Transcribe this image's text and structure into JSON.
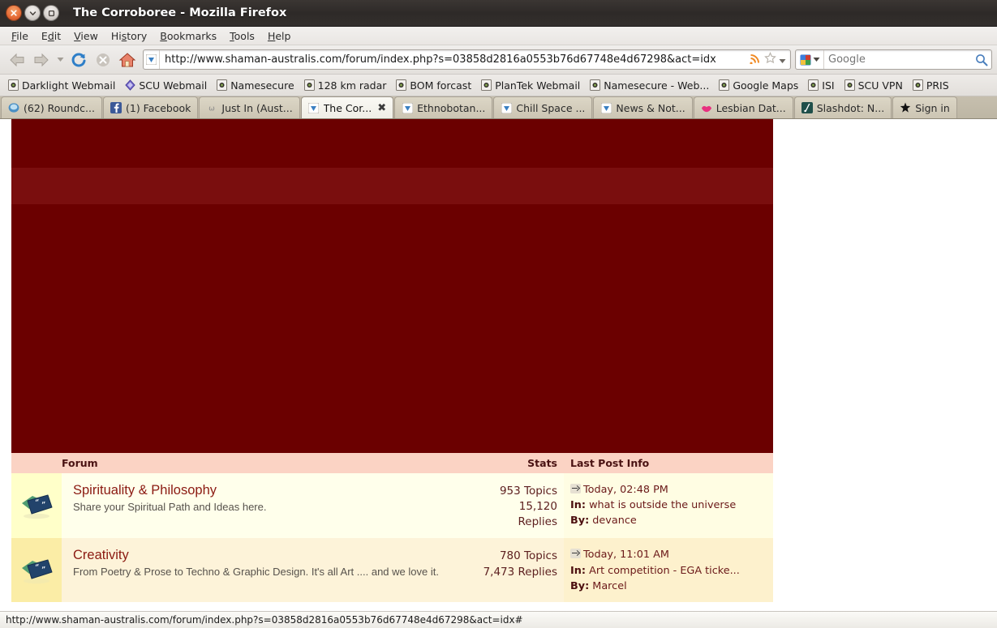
{
  "window": {
    "title": "The Corroboree - Mozilla Firefox",
    "buttons": {
      "close": "close-button",
      "minimize": "minimize-button",
      "maximize": "maximize-button"
    }
  },
  "menubar": {
    "items": [
      {
        "label": "File",
        "accel": "F"
      },
      {
        "label": "Edit",
        "accel": "E"
      },
      {
        "label": "View",
        "accel": "V"
      },
      {
        "label": "History",
        "accel": "s"
      },
      {
        "label": "Bookmarks",
        "accel": "B"
      },
      {
        "label": "Tools",
        "accel": "T"
      },
      {
        "label": "Help",
        "accel": "H"
      }
    ]
  },
  "toolbar": {
    "back_icon": "back-arrow-icon",
    "forward_icon": "forward-arrow-icon",
    "dropdown_icon": "history-dropdown-icon",
    "reload_icon": "reload-icon",
    "stop_icon": "stop-icon",
    "home_icon": "home-icon",
    "url": "http://www.shaman-australis.com/forum/index.php?s=03858d2816a0553b76d67748e4d67298&act=idx",
    "site_identity_icon": "site-favicon",
    "feed_icon": "rss-feed-icon",
    "bookmark_star_icon": "bookmark-star-icon",
    "url_dropdown_icon": "url-dropdown-icon",
    "search_engine": "Google",
    "search_placeholder": "Google",
    "search_value": "",
    "search_go_icon": "search-magnifier-icon"
  },
  "bookmarks": {
    "items": [
      {
        "label": "Darklight Webmail",
        "icon": "generic-page-icon"
      },
      {
        "label": "SCU Webmail",
        "icon": "diamond-icon"
      },
      {
        "label": "Namesecure",
        "icon": "generic-page-icon"
      },
      {
        "label": "128 km radar",
        "icon": "generic-page-icon"
      },
      {
        "label": "BOM forcast",
        "icon": "generic-page-icon"
      },
      {
        "label": "PlanTek Webmail",
        "icon": "generic-page-icon"
      },
      {
        "label": "Namesecure - Web...",
        "icon": "generic-page-icon"
      },
      {
        "label": "Google Maps",
        "icon": "generic-page-icon"
      },
      {
        "label": "ISI",
        "icon": "generic-page-icon"
      },
      {
        "label": "SCU VPN",
        "icon": "generic-page-icon"
      },
      {
        "label": "PRIS",
        "icon": "generic-page-icon"
      }
    ]
  },
  "tabs": {
    "items": [
      {
        "label": "(62) Roundc...",
        "icon": "roundcube-icon",
        "active": false,
        "closable": false
      },
      {
        "label": "(1) Facebook",
        "icon": "facebook-icon",
        "active": false,
        "closable": false
      },
      {
        "label": "Just In (Aust...",
        "icon": "abc-news-icon",
        "active": false,
        "closable": false
      },
      {
        "label": "The Cor...",
        "icon": "corroboree-icon",
        "active": true,
        "closable": true
      },
      {
        "label": "Ethnobotan...",
        "icon": "corroboree-icon",
        "active": false,
        "closable": false
      },
      {
        "label": "Chill Space ...",
        "icon": "corroboree-icon",
        "active": false,
        "closable": false
      },
      {
        "label": "News & Not...",
        "icon": "corroboree-icon",
        "active": false,
        "closable": false
      },
      {
        "label": "Lesbian Dat...",
        "icon": "lips-icon",
        "active": false,
        "closable": false
      },
      {
        "label": "Slashdot: N...",
        "icon": "slashdot-icon",
        "active": false,
        "closable": false
      },
      {
        "label": "Sign in",
        "icon": "star-icon",
        "active": false,
        "closable": false
      }
    ],
    "close_glyph": "✖"
  },
  "forum": {
    "colors": {
      "hero_dark": "#6b0000",
      "hero_light": "#7a0e0e",
      "header_bg": "#fbd3c4",
      "title_link": "#8b1a12"
    },
    "table_header": {
      "forum": "Forum",
      "stats": "Stats",
      "last_post": "Last Post Info"
    },
    "rows": [
      {
        "icon": "forum-folder-icon",
        "title": "Spirituality & Philosophy",
        "description": "Share your Spiritual Path and Ideas here.",
        "topics": "953 Topics",
        "replies": "15,120 Replies",
        "last_time": "Today, 02:48 PM",
        "last_in_label": "In:",
        "last_in": "what is outside the universe",
        "last_by_label": "By:",
        "last_by": "devance",
        "last_arrow_icon": "goto-last-post-icon"
      },
      {
        "icon": "forum-folder-icon",
        "title": "Creativity",
        "description": "From Poetry & Prose to Techno & Graphic Design. It's all Art .... and we love it.",
        "topics": "780 Topics",
        "replies": "7,473 Replies",
        "last_time": "Today, 11:01 AM",
        "last_in_label": "In:",
        "last_in": "Art competition - EGA ticke...",
        "last_by_label": "By:",
        "last_by": "Marcel",
        "last_arrow_icon": "goto-last-post-icon"
      }
    ]
  },
  "statusbar": {
    "text": "http://www.shaman-australis.com/forum/index.php?s=03858d2816a0553b76d67748e4d67298&act=idx#"
  }
}
